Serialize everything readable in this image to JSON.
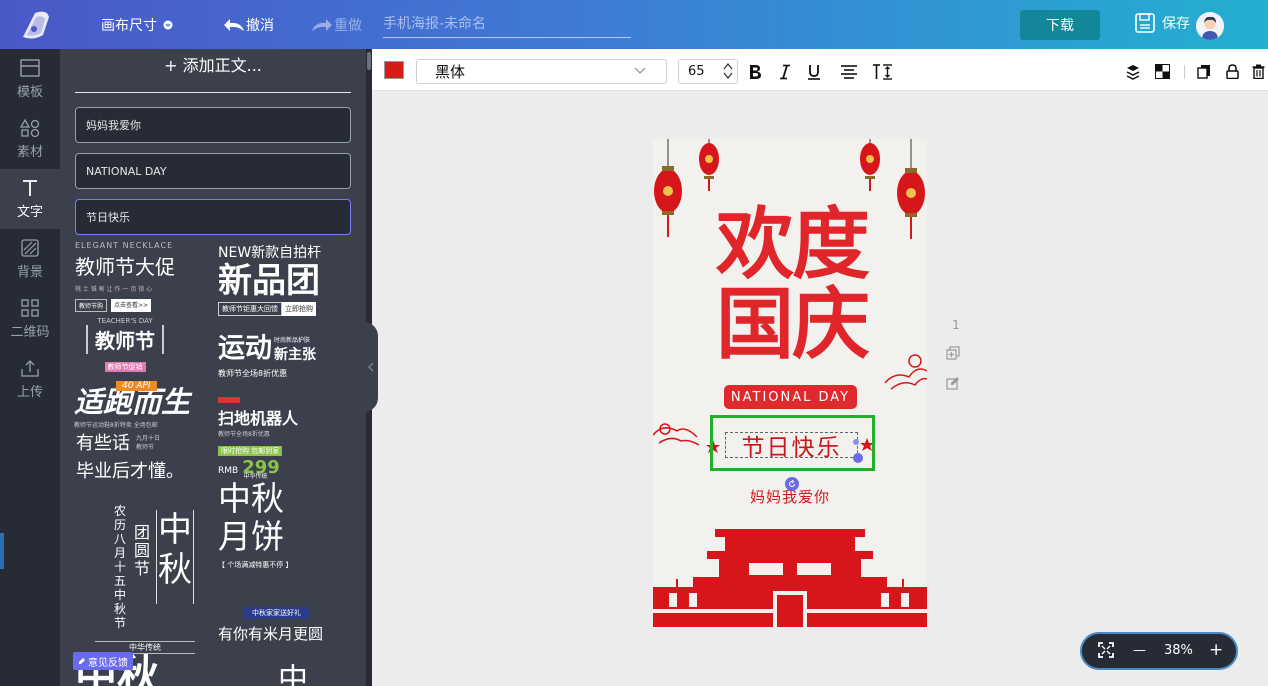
{
  "topbar": {
    "canvas_size": "画布尺寸",
    "undo": "撤消",
    "redo": "重做",
    "doc_title_placeholder": "手机海报-未命名",
    "download": "下载",
    "save": "保存"
  },
  "leftnav": [
    {
      "label": "模板",
      "icon": "template-icon"
    },
    {
      "label": "素材",
      "icon": "shapes-icon"
    },
    {
      "label": "文字",
      "icon": "text-icon",
      "active": true
    },
    {
      "label": "背景",
      "icon": "background-icon"
    },
    {
      "label": "二维码",
      "icon": "qrcode-icon"
    },
    {
      "label": "上传",
      "icon": "upload-icon"
    }
  ],
  "panel": {
    "add_text": "+ 添加正文...",
    "fields": [
      "妈妈我爱你",
      "NATIONAL DAY",
      "节日快乐"
    ],
    "templates": {
      "t1_small": "ELEGANT NECKLACE",
      "t1_big": "教师节大促",
      "t1_sub": "桃 土 锥 晰 让 作 一 页 锁 心",
      "t1_btn1": "教师节购",
      "t1_btn2": "点击查看>>",
      "t2_top": "NEW新款自拍杆",
      "t2_big": "新品团",
      "t2_bar": "教师节钜惠大回馈",
      "t2_btn": "立即抢购",
      "t3_small": "TEACHER'S DAY",
      "t3_big": "教师节",
      "t3_sub": "教师节促销",
      "t4_big": "运动",
      "t4_right": "新主张",
      "t4_small": "时尚新品护肤",
      "t4_sub": "教师节全场8折优惠",
      "t5_big": "适跑而生",
      "t5_tag": "40 API",
      "t5_sub": "教师节运动鞋8折特卖 全场包邮",
      "t6_big": "扫地机器人",
      "t6_sub": "教师节全场8折优惠",
      "t6_tag": "限时抢购 包邮到家",
      "t6_price_label": "RMB",
      "t6_price": "299",
      "t7_line1": "有些话",
      "t7_line2": "毕业后才懂。",
      "t7_small": "九月十日 教师节",
      "t8_small": "中华传统",
      "t8_line1": "中秋",
      "t8_line2": "月饼",
      "t8_sub": "【 个场满减特惠不停 】",
      "t9_col1": "农历八月十五中秋节",
      "t9_col2": "团圆节",
      "t9_big": "中秋",
      "t10_badge": "中秋家家送好礼",
      "t10_big": "有你有米月更圆",
      "t11_small": "中华传统",
      "t11_big": "中秋",
      "t12_big": "中"
    },
    "feedback": "意见反馈"
  },
  "toolbar": {
    "color": "#d41c18",
    "font": "黑体",
    "size": "65"
  },
  "canvas": {
    "headline_line1": "欢度",
    "headline_line2": "国庆",
    "national_day": "NATIONAL DAY",
    "selected_text": "节日快乐",
    "love_text": "妈妈我爱你",
    "page_number": "1"
  },
  "zoom": {
    "level": "38%",
    "minus": "—",
    "plus": "+"
  }
}
